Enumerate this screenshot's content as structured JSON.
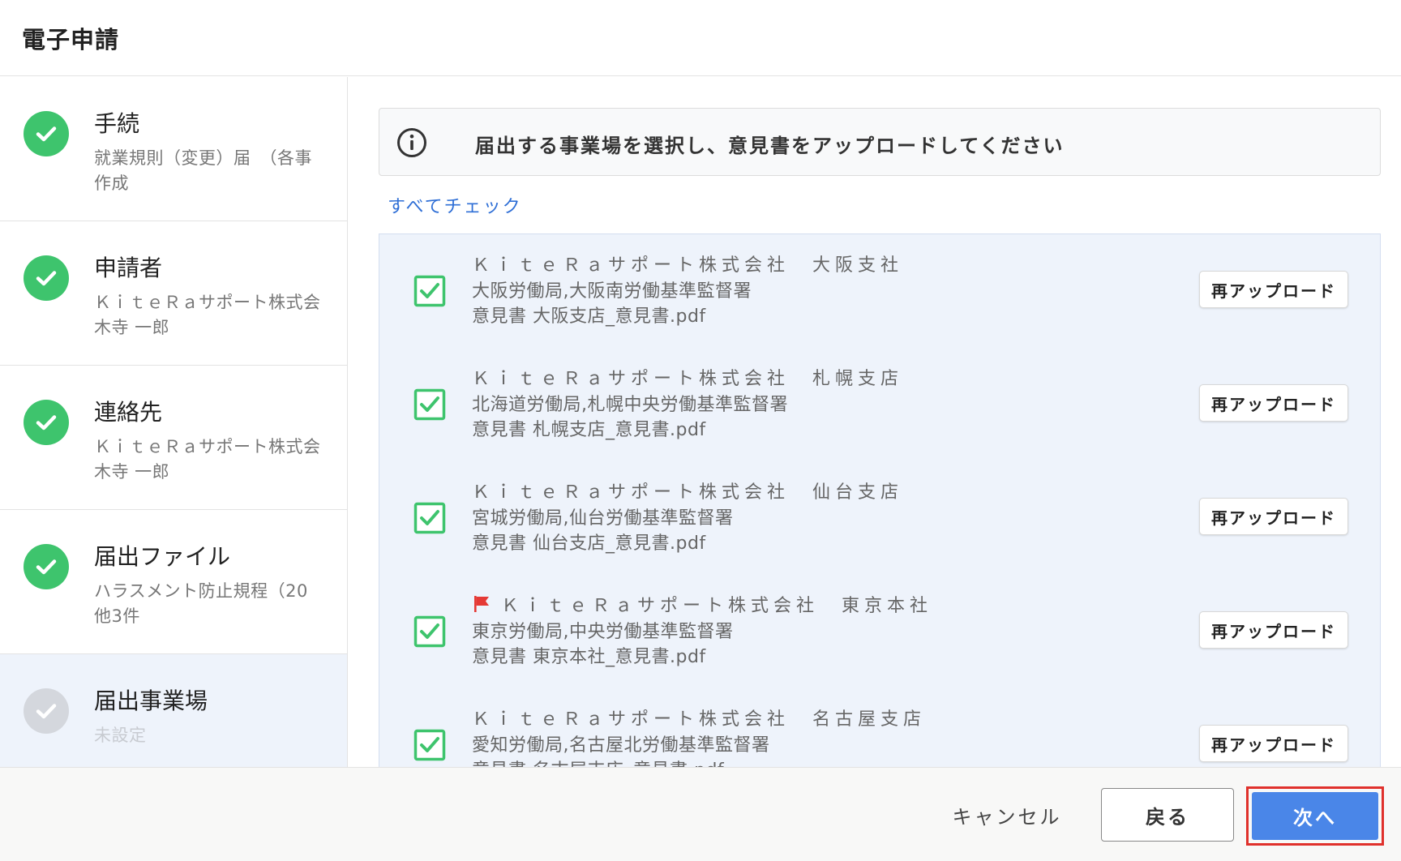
{
  "header": {
    "title": "電子申請"
  },
  "colors": {
    "done": "#3ec46d",
    "pending": "#d4d7dd",
    "accent": "#4a86e8",
    "link": "#2f6fd6",
    "highlight_border": "#e0312c",
    "flag": "#e53935"
  },
  "sidebar": {
    "steps": [
      {
        "title": "手続",
        "sub1": "就業規則（変更）届　（各事",
        "sub2": "作成",
        "status": "done",
        "icon": "check-circle-icon"
      },
      {
        "title": "申請者",
        "sub1": "ＫｉｔｅＲａサポート株式会",
        "sub2": "木寺 一郎",
        "status": "done",
        "icon": "check-circle-icon"
      },
      {
        "title": "連絡先",
        "sub1": "ＫｉｔｅＲａサポート株式会",
        "sub2": "木寺 一郎",
        "status": "done",
        "icon": "check-circle-icon"
      },
      {
        "title": "届出ファイル",
        "sub1": "ハラスメント防止規程（20",
        "sub2": "他3件",
        "status": "done",
        "icon": "check-circle-icon"
      },
      {
        "title": "届出事業場",
        "sub1": "未設定",
        "status": "pending",
        "icon": "check-circle-icon"
      }
    ]
  },
  "main": {
    "notice": {
      "text": "届出する事業場を選択し、意見書をアップロードしてください",
      "icon": "info-icon"
    },
    "check_all": "すべてチェック",
    "reupload_label": "再アップロード",
    "rows": [
      {
        "name": "ＫｉｔｅＲａサポート株式会社　大阪支社",
        "office": "大阪労働局,大阪南労働基準監督署",
        "file": "意見書 大阪支店_意見書.pdf",
        "checked": true,
        "flag": false
      },
      {
        "name": "ＫｉｔｅＲａサポート株式会社　札幌支店",
        "office": "北海道労働局,札幌中央労働基準監督署",
        "file": "意見書 札幌支店_意見書.pdf",
        "checked": true,
        "flag": false
      },
      {
        "name": "ＫｉｔｅＲａサポート株式会社　仙台支店",
        "office": "宮城労働局,仙台労働基準監督署",
        "file": "意見書 仙台支店_意見書.pdf",
        "checked": true,
        "flag": false
      },
      {
        "name": "ＫｉｔｅＲａサポート株式会社　東京本社",
        "office": "東京労働局,中央労働基準監督署",
        "file": "意見書 東京本社_意見書.pdf",
        "checked": true,
        "flag": true
      },
      {
        "name": "ＫｉｔｅＲａサポート株式会社　名古屋支店",
        "office": "愛知労働局,名古屋北労働基準監督署",
        "file": "意見書 名古屋支店_意見書.pdf",
        "checked": true,
        "flag": false
      }
    ]
  },
  "footer": {
    "cancel": "キャンセル",
    "back": "戻る",
    "next": "次へ"
  }
}
